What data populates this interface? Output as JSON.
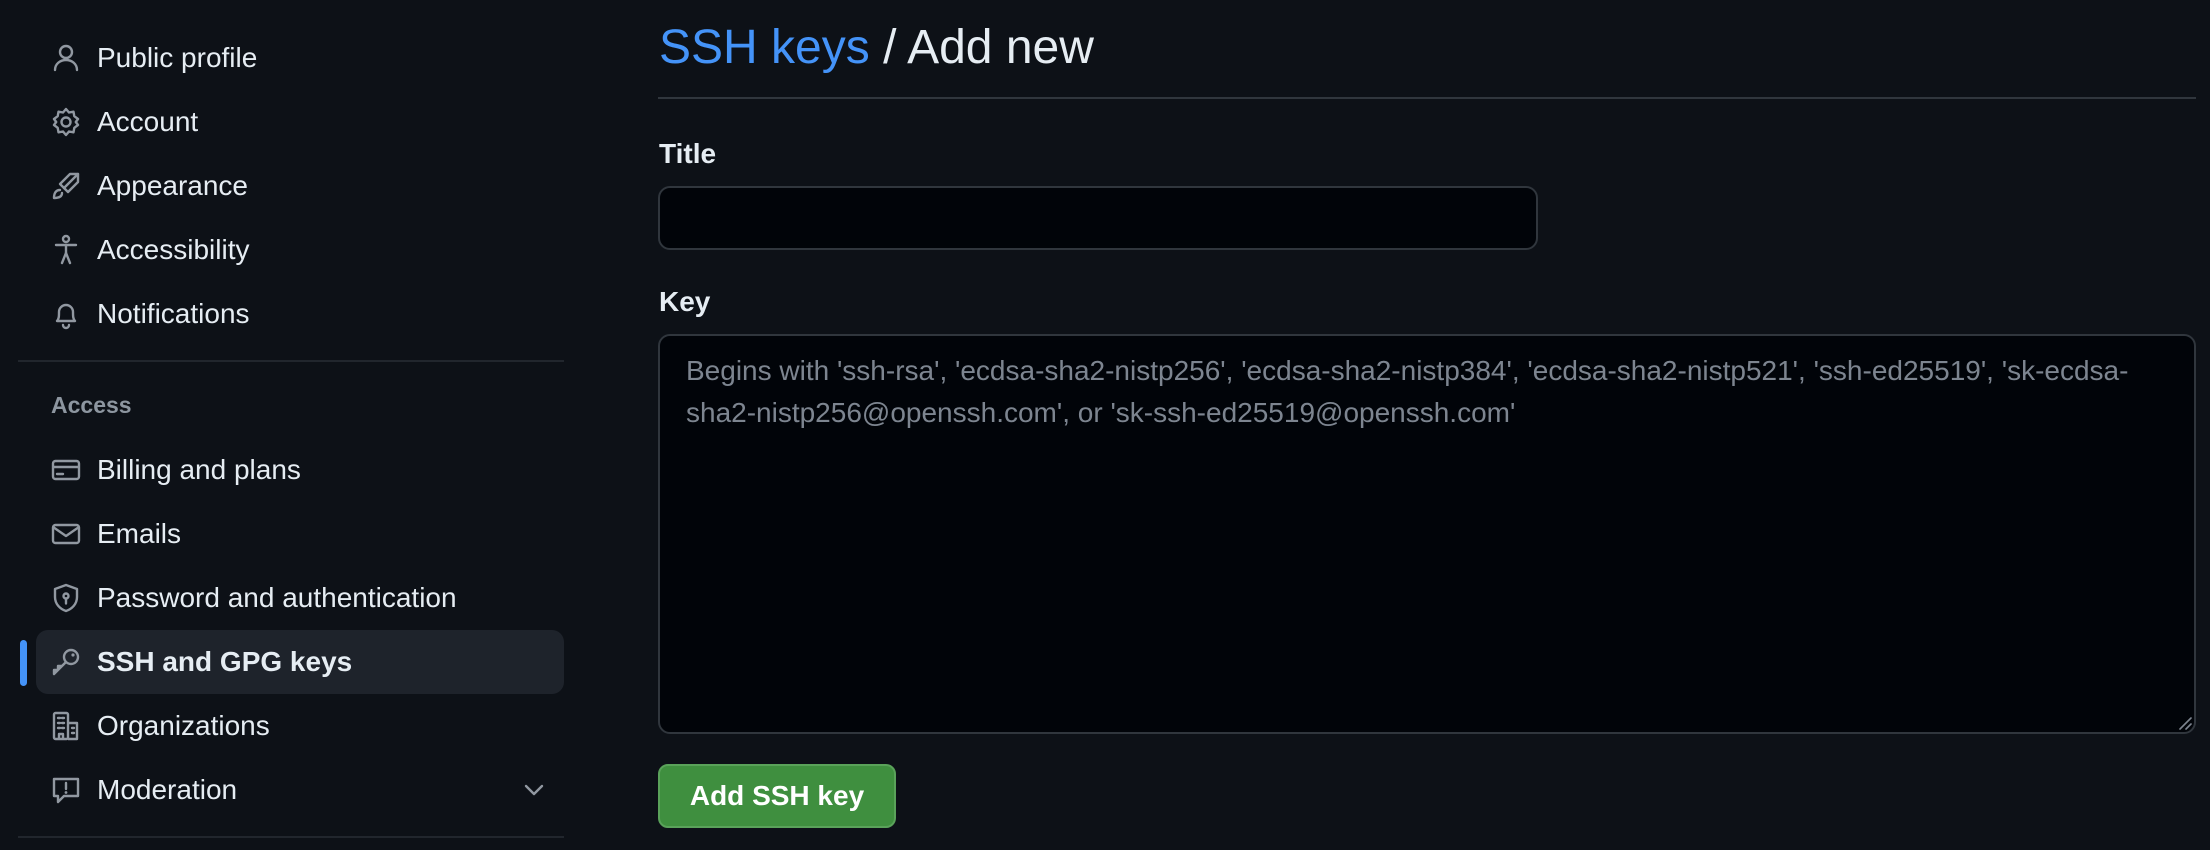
{
  "sidebar": {
    "items_top": [
      {
        "label": "Public profile",
        "icon": "person-icon"
      },
      {
        "label": "Account",
        "icon": "gear-icon"
      },
      {
        "label": "Appearance",
        "icon": "paintbrush-icon"
      },
      {
        "label": "Accessibility",
        "icon": "accessibility-icon"
      },
      {
        "label": "Notifications",
        "icon": "bell-icon"
      }
    ],
    "access_heading": "Access",
    "items_access": [
      {
        "label": "Billing and plans",
        "icon": "credit-card-icon"
      },
      {
        "label": "Emails",
        "icon": "mail-icon"
      },
      {
        "label": "Password and authentication",
        "icon": "shield-lock-icon"
      },
      {
        "label": "SSH and GPG keys",
        "icon": "key-icon",
        "active": true
      },
      {
        "label": "Organizations",
        "icon": "organization-icon"
      },
      {
        "label": "Moderation",
        "icon": "report-icon",
        "expandable": true
      }
    ]
  },
  "header": {
    "breadcrumb_link": "SSH keys",
    "separator": " / ",
    "current": "Add new"
  },
  "form": {
    "title_label": "Title",
    "title_value": "",
    "key_label": "Key",
    "key_value": "",
    "key_placeholder": "Begins with 'ssh-rsa', 'ecdsa-sha2-nistp256', 'ecdsa-sha2-nistp384', 'ecdsa-sha2-nistp521', 'ssh-ed25519', 'sk-ecdsa-sha2-nistp256@openssh.com', or 'sk-ssh-ed25519@openssh.com'",
    "submit_label": "Add SSH key"
  },
  "colors": {
    "background": "#0d1117",
    "link": "#4493f8",
    "active_marker": "#4493f8",
    "button_green": "#3f8f3f"
  }
}
